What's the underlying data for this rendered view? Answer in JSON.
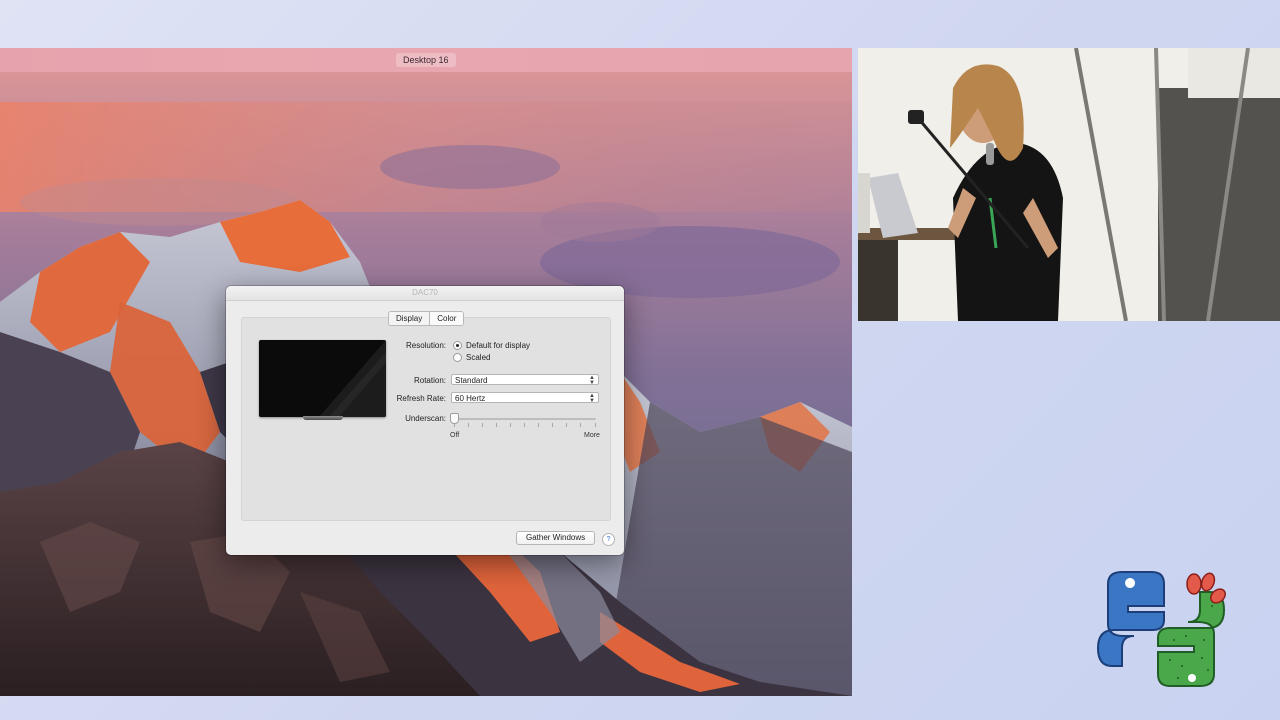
{
  "desktop": {
    "space_label": "Desktop 16"
  },
  "window": {
    "title": "DAC70",
    "tabs": [
      {
        "label": "Display",
        "active": true
      },
      {
        "label": "Color",
        "active": false
      }
    ],
    "resolution": {
      "label": "Resolution:",
      "options": [
        {
          "label": "Default for display",
          "selected": true
        },
        {
          "label": "Scaled",
          "selected": false
        }
      ]
    },
    "rotation": {
      "label": "Rotation:",
      "value": "Standard"
    },
    "refresh_rate": {
      "label": "Refresh Rate:",
      "value": "60 Hertz"
    },
    "underscan": {
      "label": "Underscan:",
      "min_label": "Off",
      "max_label": "More",
      "value_percent": 0
    },
    "gather_button": "Gather Windows",
    "help_label": "?"
  },
  "colors": {
    "menubar": "#e7a3ad",
    "window_bg": "#ececec",
    "page_bg": "#cfd6f0"
  },
  "icons": {
    "help": "question-mark-icon",
    "logo": "python-cactus-logo"
  }
}
